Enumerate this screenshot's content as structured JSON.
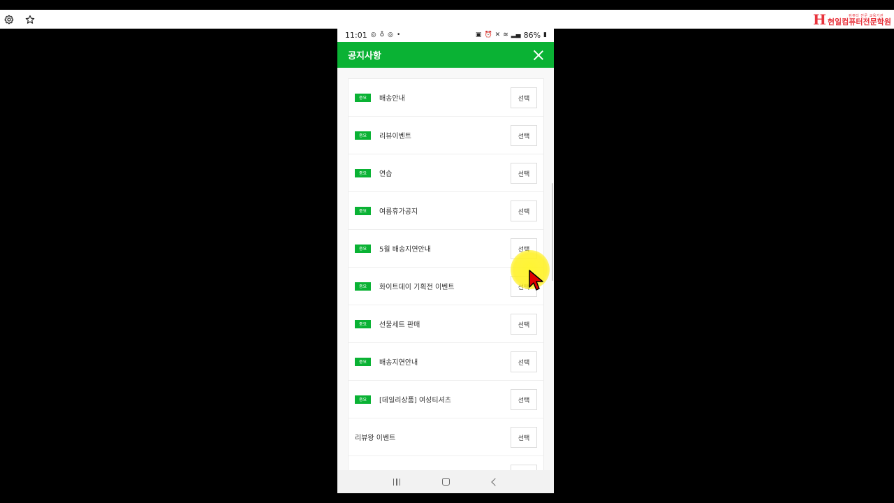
{
  "toolbar": {
    "icons": [
      "gear-icon",
      "star-icon"
    ],
    "logo": {
      "mark": "H",
      "text": "현일컴퓨터전문학원",
      "subtitle": "컴퓨터 전문 교육기관"
    }
  },
  "statusbar": {
    "time": "11:01",
    "battery": "86%"
  },
  "header": {
    "title": "공지사항"
  },
  "notices": [
    {
      "badge": "중요",
      "title": "배송안내",
      "button": "선택"
    },
    {
      "badge": "중요",
      "title": "리뷰이벤트",
      "button": "선택"
    },
    {
      "badge": "중요",
      "title": "연습",
      "button": "선택"
    },
    {
      "badge": "중요",
      "title": "여름휴가공지",
      "button": "선택"
    },
    {
      "badge": "중요",
      "title": "5월 배송지연안내",
      "button": "선택"
    },
    {
      "badge": "중요",
      "title": "화이트데이 기획전 이벤트",
      "button": "선택"
    },
    {
      "badge": "중요",
      "title": "선물세트 판매",
      "button": "선택"
    },
    {
      "badge": "중요",
      "title": "배송지연안내",
      "button": "선택"
    },
    {
      "badge": "중요",
      "title": "[데일리상품] 여성티셔츠",
      "button": "선택"
    },
    {
      "badge": "",
      "title": "리뷰왕 이벤트",
      "button": "선택"
    },
    {
      "badge": "",
      "title": "",
      "button": ""
    }
  ],
  "colors": {
    "accent": "#0ab234",
    "cursor": "#e00000",
    "highlight": "#fff028"
  }
}
